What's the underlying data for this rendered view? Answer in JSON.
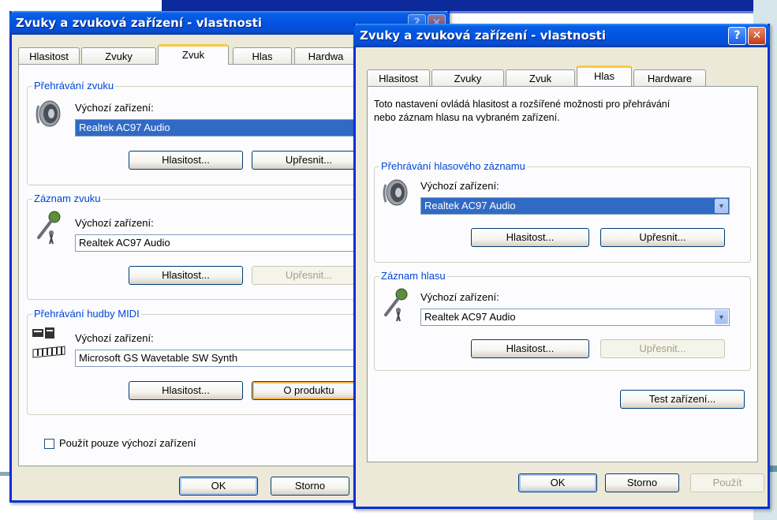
{
  "left_window": {
    "title": "Zvuky a zvuková zařízení - vlastnosti",
    "tabs": [
      "Hlasitost",
      "Zvuky",
      "Zvuk",
      "Hlas",
      "Hardwa"
    ],
    "active_tab": "Zvuk",
    "playback": {
      "group_title": "Přehrávání zvuku",
      "default_device_label": "Výchozí zařízení:",
      "device": "Realtek AC97 Audio",
      "volume_button": "Hlasitost...",
      "advanced_button": "Upřesnit..."
    },
    "recording": {
      "group_title": "Záznam zvuku",
      "default_device_label": "Výchozí zařízení:",
      "device": "Realtek AC97 Audio",
      "volume_button": "Hlasitost...",
      "advanced_button": "Upřesnit..."
    },
    "midi": {
      "group_title": "Přehrávání hudby MIDI",
      "default_device_label": "Výchozí zařízení:",
      "device": "Microsoft GS Wavetable SW Synth",
      "volume_button": "Hlasitost...",
      "about_button": "O produktu"
    },
    "use_only_default_label": "Použít pouze výchozí zařízení",
    "ok_button": "OK",
    "cancel_button": "Storno"
  },
  "right_window": {
    "title": "Zvuky a zvuková zařízení - vlastnosti",
    "help_glyph": "?",
    "close_glyph": "✕",
    "tabs": [
      "Hlasitost",
      "Zvuky",
      "Zvuk",
      "Hlas",
      "Hardware"
    ],
    "active_tab": "Hlas",
    "description_line1": "Toto nastavení ovládá hlasitost a rozšířené možnosti pro přehrávání",
    "description_line2": "nebo záznam hlasu na vybraném zařízení.",
    "voice_playback": {
      "group_title": "Přehrávání hlasového záznamu",
      "default_device_label": "Výchozí zařízení:",
      "device": "Realtek AC97 Audio",
      "volume_button": "Hlasitost...",
      "advanced_button": "Upřesnit..."
    },
    "voice_recording": {
      "group_title": "Záznam hlasu",
      "default_device_label": "Výchozí zařízení:",
      "device": "Realtek AC97 Audio",
      "volume_button": "Hlasitost...",
      "advanced_button": "Upřesnit..."
    },
    "test_button": "Test zařízení...",
    "ok_button": "OK",
    "cancel_button": "Storno",
    "apply_button": "Použít"
  },
  "icons": {
    "speaker": "speaker-icon",
    "microphone": "microphone-icon",
    "midi": "midi-keyboard-icon",
    "dropdown": "chevron-down-icon"
  },
  "colors": {
    "titlebar": "#0054e3",
    "window_bg": "#ece9d8",
    "group_title": "#0046d5",
    "selection": "#316ac5",
    "active_tab_accent": "#ffc83c"
  }
}
